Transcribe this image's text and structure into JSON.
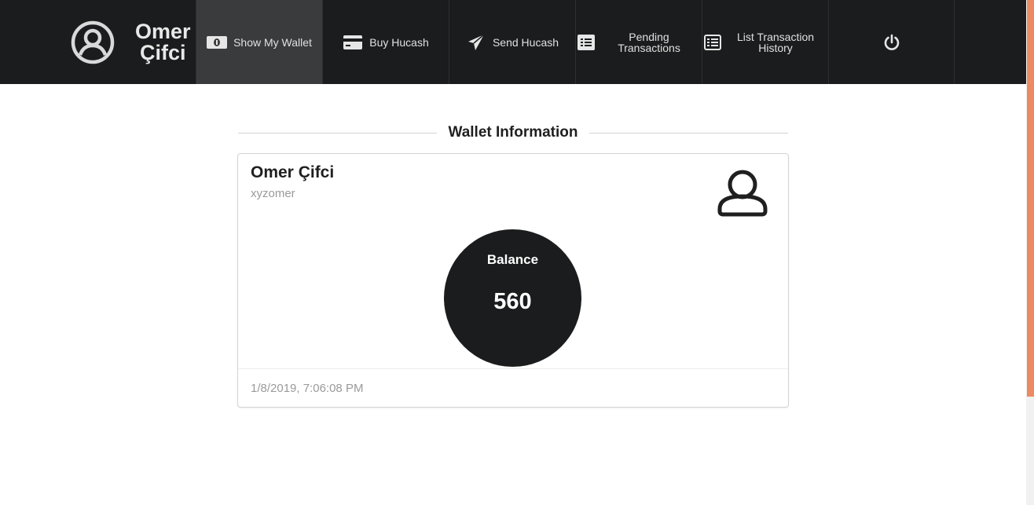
{
  "user": {
    "first_name": "Omer",
    "last_name": "Çifci",
    "full_name": "Omer Çifci",
    "username": "xyzomer"
  },
  "nav": {
    "items": [
      {
        "label": "Show My Wallet",
        "icon": "money-icon",
        "active": true
      },
      {
        "label": "Buy Hucash",
        "icon": "credit-card-icon"
      },
      {
        "label": "Send Hucash",
        "icon": "paper-plane-icon"
      },
      {
        "label_line1": "Pending",
        "label_line2": "Transactions",
        "icon": "list-icon"
      },
      {
        "label_line1": "List Transaction",
        "label_line2": "History",
        "icon": "list-icon"
      }
    ],
    "logout_icon": "power-icon"
  },
  "wallet": {
    "section_title": "Wallet Information",
    "balance_label": "Balance",
    "balance_value": "560",
    "timestamp": "1/8/2019, 7:06:08 PM"
  },
  "colors": {
    "navbar": "#1b1c1d",
    "active_item": "#3a3b3c",
    "scroll_thumb": "#ec8a63"
  }
}
